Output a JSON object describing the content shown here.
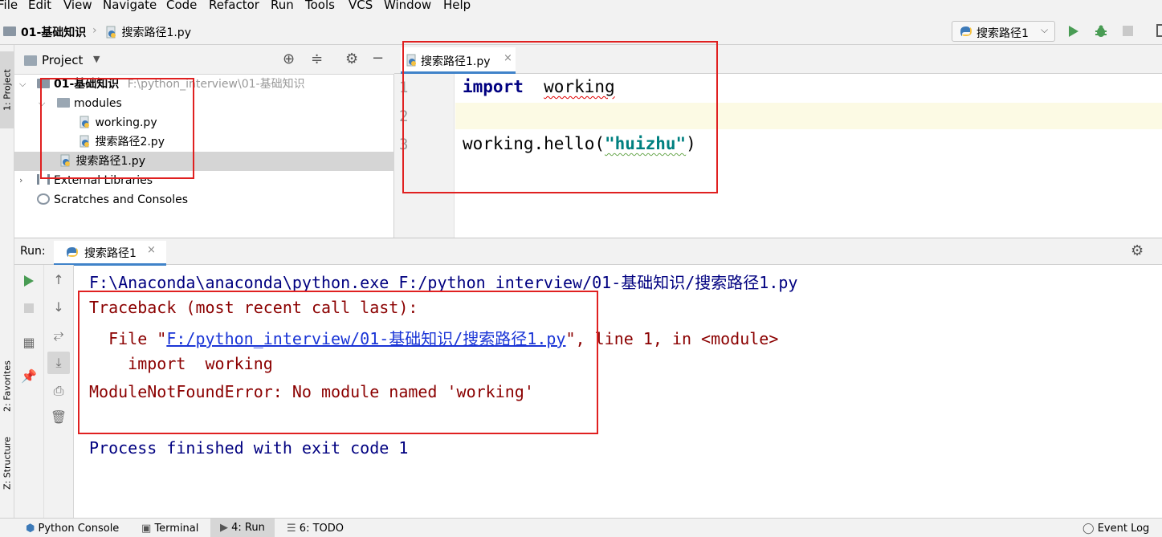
{
  "menu": [
    "File",
    "Edit",
    "View",
    "Navigate",
    "Code",
    "Refactor",
    "Run",
    "Tools",
    "VCS",
    "Window",
    "Help"
  ],
  "breadcrumb": {
    "project": "01-基础知识",
    "file": "搜索路径1.py"
  },
  "run_config": {
    "label": "搜索路径1"
  },
  "left_stripe": {
    "project_tab": "1: Project",
    "favorites_tab": "2: Favorites",
    "structure_tab": "Z: Structure"
  },
  "project_panel": {
    "title": "Project",
    "tree": {
      "root_name": "01-基础知识",
      "root_path": "F:\\python_interview\\01-基础知识",
      "modules_folder": "modules",
      "module_file_1": "working.py",
      "module_file_2": "搜索路径2.py",
      "root_file": "搜索路径1.py",
      "external_libraries": "External Libraries",
      "scratches": "Scratches and Consoles"
    }
  },
  "editor": {
    "tab_label": "搜索路径1.py",
    "line_numbers": [
      "1",
      "2",
      "3"
    ],
    "code": {
      "line1_kw": "import",
      "line1_mod": "working",
      "line3_pre": "working.hello(",
      "line3_str": "\"huizhu\"",
      "line3_post": ")"
    }
  },
  "run_panel": {
    "label": "Run:",
    "tab_label": "搜索路径1",
    "console": {
      "cmd": "F:\\Anaconda\\anaconda\\python.exe F:/python_interview/01-基础知识/搜索路径1.py",
      "traceback": "Traceback (most recent call last):",
      "file_prefix": "  File \"",
      "file_link": "F:/python_interview/01-基础知识/搜索路径1.py",
      "file_suffix": "\", line 1, in <module>",
      "import_line": "    import  working",
      "error": "ModuleNotFoundError: No module named 'working'",
      "finished": "Process finished with exit code 1"
    }
  },
  "bottom_bar": {
    "python_console": "Python Console",
    "terminal": "Terminal",
    "run": "4: Run",
    "todo": "6: TODO",
    "event_log": "Event Log"
  },
  "colors": {
    "accent": "#4083c9",
    "annotation_red": "#e02020",
    "keyword": "#000080",
    "string": "#008080",
    "error": "#8b0000"
  }
}
